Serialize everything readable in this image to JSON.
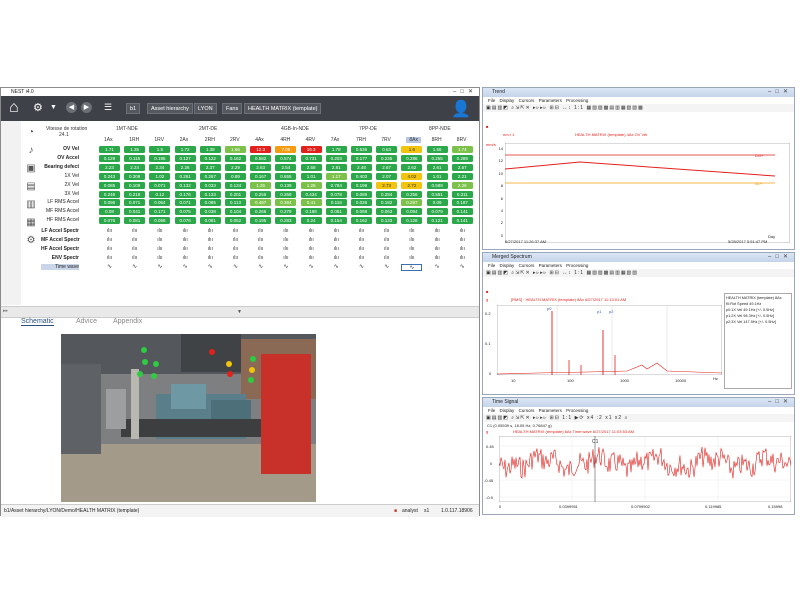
{
  "main": {
    "title": "NEST i4.0",
    "breadcrumbs": [
      "b1",
      "Asset hierarchy",
      "LYON",
      "Fans",
      "HEALTH MATRIX (template)"
    ],
    "speed_label": "Vitesse de rotation",
    "speed_value": "24.1",
    "groups": [
      "1MT-NDE",
      "2MT-DE",
      "4GB-In-NDE",
      "7PP-DE",
      "8PP-NDE"
    ],
    "columns": [
      "1Ax",
      "1RH",
      "1RV",
      "2Ax",
      "2RH",
      "2RV",
      "4Ax",
      "4RH",
      "4RV",
      "7Ax",
      "7RH",
      "7RV",
      "8Ax",
      "8RH",
      "8RV"
    ],
    "rows": [
      {
        "label": "OV Vel",
        "values": [
          "1.71",
          "1.35",
          "1.5",
          "1.72",
          "1.38",
          "1.66",
          "12.3",
          "7.06",
          "16.3",
          "1.78",
          "0.636",
          "0.63",
          "1.6",
          "1.55",
          "1.74"
        ],
        "colors": [
          "g",
          "g",
          "g",
          "g",
          "g",
          "lg",
          "r",
          "o",
          "r",
          "g",
          "g",
          "g",
          "y",
          "g",
          "lg"
        ]
      },
      {
        "label": "OV Accel",
        "values": [
          "0.129",
          "0.115",
          "0.195",
          "0.127",
          "0.122",
          "0.162",
          "0.582",
          "0.574",
          "0.731",
          "0.203",
          "0.177",
          "0.235",
          "0.286",
          "0.255",
          "0.289"
        ],
        "colors": [
          "g",
          "g",
          "g",
          "g",
          "g",
          "g",
          "g",
          "g",
          "g",
          "g",
          "g",
          "g",
          "g",
          "g",
          "g"
        ]
      },
      {
        "label": "Bearing defect",
        "values": [
          "2.23",
          "2.24",
          "2.34",
          "2.26",
          "2.37",
          "2.29",
          "2.63",
          "2.54",
          "2.58",
          "2.81",
          "2.48",
          "2.67",
          "2.62",
          "2.61",
          "2.67"
        ],
        "colors": [
          "g",
          "g",
          "g",
          "g",
          "g",
          "g",
          "g",
          "g",
          "g",
          "g",
          "g",
          "g",
          "g",
          "g",
          "g"
        ]
      },
      {
        "label": "1X Vel",
        "values": [
          "0.243",
          "0.309",
          "1.02",
          "0.261",
          "0.267",
          "0.89",
          "0.167",
          "0.655",
          "1.01",
          "1.17",
          "0.403",
          "2.07",
          "4.02",
          "1.01",
          "2.21"
        ],
        "colors": [
          "g",
          "g",
          "g",
          "g",
          "g",
          "g",
          "g",
          "g",
          "g",
          "lg",
          "g",
          "g",
          "y",
          "g",
          "g"
        ]
      },
      {
        "label": "2X Vel",
        "values": [
          "0.085",
          "0.109",
          "0.071",
          "0.132",
          "0.033",
          "0.134",
          "1.26",
          "0.139",
          "1.26",
          "0.784",
          "0.199",
          "2.73",
          "2.72",
          "0.589",
          "2.26"
        ],
        "colors": [
          "g",
          "g",
          "g",
          "g",
          "g",
          "g",
          "lg",
          "g",
          "lg",
          "g",
          "g",
          "y",
          "y",
          "g",
          "lg"
        ]
      },
      {
        "label": "3X Vel",
        "values": [
          "0.246",
          "0.218",
          "0.12",
          "0.176",
          "0.133",
          "0.201",
          "0.256",
          "0.269",
          "0.434",
          "0.078",
          "0.089",
          "0.284",
          "0.256",
          "0.551",
          "0.311"
        ],
        "colors": [
          "g",
          "g",
          "g",
          "g",
          "g",
          "g",
          "g",
          "g",
          "g",
          "g",
          "g",
          "g",
          "g",
          "g",
          "g"
        ]
      },
      {
        "label": "LF RMS Accel",
        "values": [
          "0.096",
          "0.071",
          "0.064",
          "0.071",
          "0.085",
          "0.113",
          "0.487",
          "0.384",
          "0.41",
          "0.118",
          "0.026",
          "0.182",
          "0.297",
          "0.09",
          "0.187"
        ],
        "colors": [
          "g",
          "g",
          "g",
          "g",
          "g",
          "g",
          "lg",
          "lg",
          "lg",
          "g",
          "g",
          "g",
          "lg",
          "g",
          "g"
        ]
      },
      {
        "label": "MF RMS Accel",
        "values": [
          "0.08",
          "0.041",
          "0.171",
          "0.075",
          "0.038",
          "0.104",
          "0.266",
          "0.279",
          "0.188",
          "0.061",
          "0.068",
          "0.063",
          "0.094",
          "0.079",
          "0.141"
        ],
        "colors": [
          "g",
          "g",
          "g",
          "g",
          "g",
          "g",
          "g",
          "g",
          "g",
          "g",
          "g",
          "g",
          "g",
          "g",
          "g"
        ]
      },
      {
        "label": "HF RMS Accel",
        "values": [
          "0.076",
          "0.081",
          "0.068",
          "0.076",
          "0.081",
          "0.052",
          "0.195",
          "0.283",
          "0.24",
          "0.154",
          "0.162",
          "0.133",
          "0.128",
          "0.121",
          "0.141"
        ],
        "colors": [
          "g",
          "g",
          "g",
          "g",
          "g",
          "g",
          "g",
          "g",
          "g",
          "g",
          "g",
          "g",
          "g",
          "g",
          "g"
        ]
      }
    ],
    "spectrum_rows": [
      "LF Accel Spectr",
      "MF Accel Spectr",
      "HF Accel Spectr",
      "ENV Spectr"
    ],
    "time_row": "Time wave",
    "tabs": [
      "Schematic",
      "Advice",
      "Appendix"
    ],
    "status_path": "b1/Asset hierarchy/LYON/Demo/HEALTH MATRIX (template)",
    "status_brand": "analyst",
    "status_user": "s1",
    "status_version": "1.0.117.18906"
  },
  "trend": {
    "title": "Trend",
    "menu": [
      "File",
      "Display",
      "Cursors",
      "Parameters",
      "Processing"
    ],
    "point_label": "nm.r 1",
    "chart_title": "HEALTH MATRIX (template) 4Ax OV Vel",
    "unit": "mm/s",
    "x_start": "6/27/2017 11:26:37 AM",
    "x_end": "5/28/2017 5:51:47 PM",
    "x_unit": "Day",
    "danger_label": "DG+",
    "alert_label": "AL+",
    "y_ticks": [
      "14",
      "12",
      "10",
      "8",
      "6",
      "4",
      "2",
      "0"
    ]
  },
  "spectrum": {
    "title": "Merged Spectrum",
    "menu": [
      "File",
      "Display",
      "Cursors",
      "Parameters",
      "Processing"
    ],
    "chart_title": "[RMS] : HEALTH MATRIX (template) 8Ax 6/27/2017 11:13:01 AM",
    "unit": "g",
    "y_ticks": [
      "0.2",
      "0.1",
      "0"
    ],
    "x_ticks": [
      "10",
      "100",
      "1000",
      "10000"
    ],
    "x_unit": "Hz",
    "legend": [
      "HEALTH MATRIX (template) 8Ax",
      "f0:Rot Speed 49.1Hz",
      "p0:1X Vel 49.1Hz [+/- 0.5Hz]",
      "p1:2X Vel 98.3Hz [+/- 0.5Hz]",
      "p2:3X Vel 147.5Hz [+/- 0.5Hz]"
    ]
  },
  "timesig": {
    "title": "Time Signal",
    "menu": [
      "File",
      "Display",
      "Cursors",
      "Parameters",
      "Processing"
    ],
    "cursor": "C1 (0.05539 s, 18.05 Hz, 0.76847 g)",
    "chart_title": "HEALTH MATRIX (template) 8Ax Time wave 6/27/2017 11:03:53 AM",
    "unit": "g",
    "y_ticks": [
      "0.45",
      "0",
      "-0.45",
      "-0.9"
    ],
    "x_ticks": [
      "0",
      "0.0399951",
      "0.0799902",
      "0.119985",
      "0.15998"
    ],
    "x_unit": "s",
    "cursor_label": "C1"
  },
  "colors": {
    "green": "#2ba84a",
    "yellow": "#f1c40f",
    "orange": "#f39c12",
    "red": "#e2201c",
    "toolbar": "#3e4147",
    "signal": "#e2201c"
  }
}
